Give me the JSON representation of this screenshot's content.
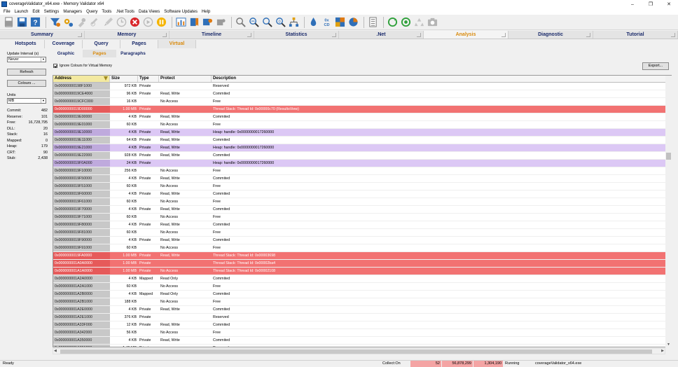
{
  "window": {
    "title": "coverageValidator_x64.exe - Memory Validator x64",
    "minimize": "–",
    "maximize": "❐",
    "close": "✕"
  },
  "menu": [
    "File",
    "Launch",
    "Edit",
    "Settings",
    "Managers",
    "Query",
    "Tools",
    ".Net Tools",
    "Data Views",
    "Software Updates",
    "Help"
  ],
  "toolbar": {
    "icons": [
      "new-icon",
      "save-icon",
      "help-icon",
      "filter-icon",
      "settings-gear-icon",
      "pin-icon",
      "link-icon",
      "brush-icon",
      "clock-icon",
      "stop-icon",
      "play-icon",
      "pause-icon",
      "chart-icon",
      "bookmark-icon",
      "plugin-icon",
      "puzzle-icon",
      "search-icon",
      "zoom-icon",
      "find-icon",
      "find-next-icon",
      "tree-icon",
      "drop-icon",
      "hex-icon",
      "grid-icon",
      "pie-icon",
      "list-icon",
      "refresh-icon",
      "refresh-all-icon",
      "recycle-icon",
      "camera-icon"
    ],
    "hex_label": "0x\nCD"
  },
  "main_tabs": [
    {
      "label": "Summary",
      "active": false
    },
    {
      "label": "Memory",
      "active": false
    },
    {
      "label": "Timeline",
      "active": false
    },
    {
      "label": "Statistics",
      "active": false
    },
    {
      "label": ".Net",
      "active": false
    },
    {
      "label": "Analysis",
      "active": true
    },
    {
      "label": "Diagnostic",
      "active": false
    },
    {
      "label": "Tutorial",
      "active": false
    }
  ],
  "sub_tabs": [
    {
      "label": "Hotspots",
      "active": false
    },
    {
      "label": "Coverage",
      "active": false
    },
    {
      "label": "Query",
      "active": false
    },
    {
      "label": "Pages",
      "active": false
    },
    {
      "label": "Virtual",
      "active": true
    }
  ],
  "view_tabs": [
    {
      "label": "Graphic",
      "active": false
    },
    {
      "label": "Pages",
      "active": true
    },
    {
      "label": "Paragraphs",
      "active": false
    }
  ],
  "left_panel": {
    "update_label": "Update Interval (s)",
    "update_value": "Never",
    "refresh_button": "Refresh",
    "colours_button": "Colours ...",
    "units_label": "Units",
    "units_value": "MB",
    "stats": [
      {
        "label": "Commit:",
        "value": "482"
      },
      {
        "label": "Reserve:",
        "value": "101"
      },
      {
        "label": "Free:",
        "value": "16,728,795"
      },
      {
        "label": "DLL:",
        "value": "20"
      },
      {
        "label": "Stack:",
        "value": "16"
      },
      {
        "label": "Mapped:",
        "value": "0"
      },
      {
        "label": "Heap:",
        "value": "179"
      },
      {
        "label": "CRT:",
        "value": "90"
      },
      {
        "label": "Stub:",
        "value": "2,438"
      }
    ]
  },
  "options": {
    "ignore_colours_label": "Ignore Colours for Virtual Memory",
    "export_button": "Export..."
  },
  "table": {
    "headers": [
      "Address",
      "Size",
      "Type",
      "Protect",
      "Description"
    ],
    "rows": [
      {
        "addr": "0x00000000198F1000",
        "size": "972 KB",
        "type": "Private",
        "protect": "",
        "desc": "Reserved",
        "kind": ""
      },
      {
        "addr": "0x0000000019CE4000",
        "size": "96 KB",
        "type": "Private",
        "protect": "Read, Write",
        "desc": "Commited",
        "kind": ""
      },
      {
        "addr": "0x0000000019CFC000",
        "size": "16 KB",
        "type": "",
        "protect": "No Access",
        "desc": "Free",
        "kind": ""
      },
      {
        "addr": "0x0000000019D00000",
        "size": "1.00 MB",
        "type": "Private",
        "protect": "",
        "desc": "Thread Stack: Thread Id: 0x00000c70 (ResultsView)",
        "kind": "thread"
      },
      {
        "addr": "0x0000000019E00000",
        "size": "4 KB",
        "type": "Private",
        "protect": "Read, Write",
        "desc": "Commited",
        "kind": ""
      },
      {
        "addr": "0x0000000019E01000",
        "size": "60 KB",
        "type": "",
        "protect": "No Access",
        "desc": "Free",
        "kind": ""
      },
      {
        "addr": "0x0000000019E10000",
        "size": "4 KB",
        "type": "Private",
        "protect": "Read, Write",
        "desc": "Heap: handle: 0x0000000017260000",
        "kind": "heap"
      },
      {
        "addr": "0x0000000019E11000",
        "size": "64 KB",
        "type": "Private",
        "protect": "Read, Write",
        "desc": "Commited",
        "kind": ""
      },
      {
        "addr": "0x0000000019E21000",
        "size": "4 KB",
        "type": "Private",
        "protect": "Read, Write",
        "desc": "Heap: handle: 0x0000000017260000",
        "kind": "heap"
      },
      {
        "addr": "0x0000000019E22000",
        "size": "928 KB",
        "type": "Private",
        "protect": "Read, Write",
        "desc": "Commited",
        "kind": ""
      },
      {
        "addr": "0x0000000019F0A000",
        "size": "24 KB",
        "type": "Private",
        "protect": "",
        "desc": "Heap: handle: 0x0000000017260000",
        "kind": "heap"
      },
      {
        "addr": "0x0000000019F10000",
        "size": "256 KB",
        "type": "",
        "protect": "No Access",
        "desc": "Free",
        "kind": ""
      },
      {
        "addr": "0x0000000019F50000",
        "size": "4 KB",
        "type": "Private",
        "protect": "Read, Write",
        "desc": "Commited",
        "kind": ""
      },
      {
        "addr": "0x0000000019F51000",
        "size": "60 KB",
        "type": "",
        "protect": "No Access",
        "desc": "Free",
        "kind": ""
      },
      {
        "addr": "0x0000000019F60000",
        "size": "4 KB",
        "type": "Private",
        "protect": "Read, Write",
        "desc": "Commited",
        "kind": ""
      },
      {
        "addr": "0x0000000019F61000",
        "size": "60 KB",
        "type": "",
        "protect": "No Access",
        "desc": "Free",
        "kind": ""
      },
      {
        "addr": "0x0000000019F70000",
        "size": "4 KB",
        "type": "Private",
        "protect": "Read, Write",
        "desc": "Commited",
        "kind": ""
      },
      {
        "addr": "0x0000000019F71000",
        "size": "60 KB",
        "type": "",
        "protect": "No Access",
        "desc": "Free",
        "kind": ""
      },
      {
        "addr": "0x0000000019F80000",
        "size": "4 KB",
        "type": "Private",
        "protect": "Read, Write",
        "desc": "Commited",
        "kind": ""
      },
      {
        "addr": "0x0000000019F81000",
        "size": "60 KB",
        "type": "",
        "protect": "No Access",
        "desc": "Free",
        "kind": ""
      },
      {
        "addr": "0x0000000019F90000",
        "size": "4 KB",
        "type": "Private",
        "protect": "Read, Write",
        "desc": "Commited",
        "kind": ""
      },
      {
        "addr": "0x0000000019F91000",
        "size": "60 KB",
        "type": "",
        "protect": "No Access",
        "desc": "Free",
        "kind": ""
      },
      {
        "addr": "0x0000000019FA0000",
        "size": "1.00 MB",
        "type": "Private",
        "protect": "Read, Write",
        "desc": "Thread Stack: Thread Id: 0x00003698",
        "kind": "thread"
      },
      {
        "addr": "0x000000001A0A0000",
        "size": "1.00 MB",
        "type": "Private",
        "protect": "",
        "desc": "Thread Stack: Thread Id: 0x00002ba4",
        "kind": "thread"
      },
      {
        "addr": "0x000000001A1A0000",
        "size": "1.00 MB",
        "type": "Private",
        "protect": "No Access",
        "desc": "Thread Stack: Thread Id: 0x00002108",
        "kind": "thread"
      },
      {
        "addr": "0x000000001A2A0000",
        "size": "4 KB",
        "type": "Mapped",
        "protect": "Read Only",
        "desc": "Commited",
        "kind": ""
      },
      {
        "addr": "0x000000001A2A1000",
        "size": "60 KB",
        "type": "",
        "protect": "No Access",
        "desc": "Free",
        "kind": ""
      },
      {
        "addr": "0x000000001A2B0000",
        "size": "4 KB",
        "type": "Mapped",
        "protect": "Read Only",
        "desc": "Commited",
        "kind": ""
      },
      {
        "addr": "0x000000001A2B1000",
        "size": "188 KB",
        "type": "",
        "protect": "No Access",
        "desc": "Free",
        "kind": ""
      },
      {
        "addr": "0x000000001A2E0000",
        "size": "4 KB",
        "type": "Private",
        "protect": "Read, Write",
        "desc": "Commited",
        "kind": ""
      },
      {
        "addr": "0x000000001A2E1000",
        "size": "376 KB",
        "type": "Private",
        "protect": "",
        "desc": "Reserved",
        "kind": ""
      },
      {
        "addr": "0x000000001A33F000",
        "size": "12 KB",
        "type": "Private",
        "protect": "Read, Write",
        "desc": "Commited",
        "kind": ""
      },
      {
        "addr": "0x000000001A342000",
        "size": "56 KB",
        "type": "",
        "protect": "No Access",
        "desc": "Free",
        "kind": ""
      },
      {
        "addr": "0x000000001A350000",
        "size": "4 KB",
        "type": "Private",
        "protect": "Read, Write",
        "desc": "Commited",
        "kind": ""
      },
      {
        "addr": "0x000000001A351000",
        "size": "1.45 MB",
        "type": "Private",
        "protect": "",
        "desc": "Reserved",
        "kind": ""
      }
    ]
  },
  "status": {
    "ready": "Ready",
    "collect": "Collect:On",
    "v1": "52",
    "v2": "56,878,299",
    "v3": "1,304,190",
    "state": "Running",
    "exe": "coverageValidator_x64.exe"
  }
}
